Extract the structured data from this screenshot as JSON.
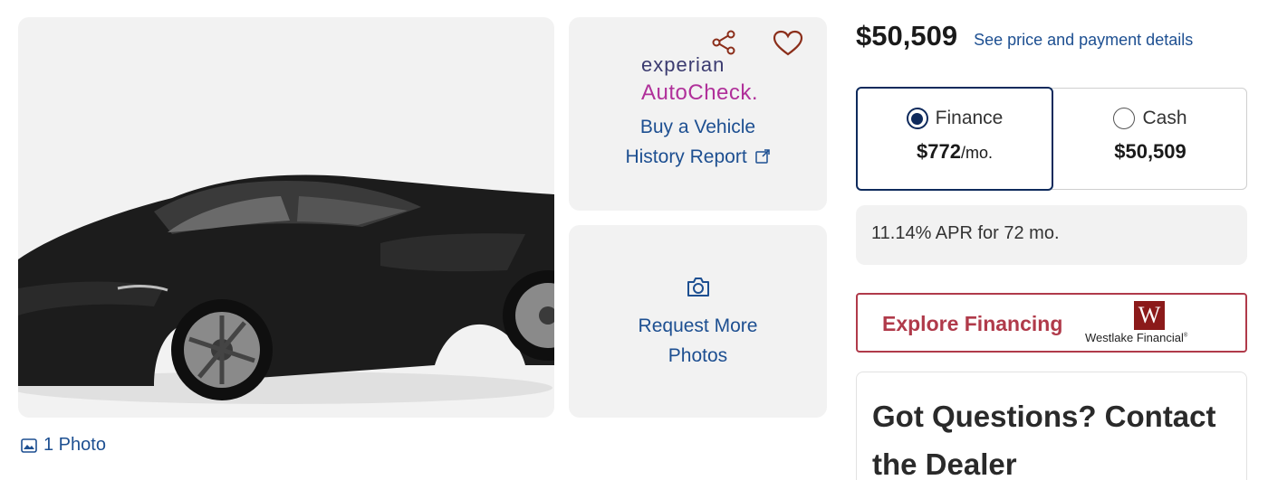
{
  "gallery": {
    "photo_count_label": "1 Photo"
  },
  "history_card": {
    "brand_top": "experian",
    "brand_bottom": "AutoCheck.",
    "link_line1": "Buy a Vehicle",
    "link_line2": "History Report"
  },
  "photos_card": {
    "link_line1": "Request More",
    "link_line2": "Photos"
  },
  "pricing": {
    "price": "$50,509",
    "details_link": "See price and payment details",
    "finance": {
      "label": "Finance",
      "amount": "$772",
      "unit": "/mo.",
      "selected": true
    },
    "cash": {
      "label": "Cash",
      "amount": "$50,509",
      "selected": false
    },
    "apr_text": "11.14% APR for 72 mo."
  },
  "financing": {
    "button_label": "Explore Financing",
    "partner_logo_letter": "W",
    "partner_name": "Westlake Financial"
  },
  "contact": {
    "title": "Got Questions? Contact the Dealer"
  },
  "colors": {
    "link_blue": "#1d4f91",
    "navy": "#0e2a5c",
    "finance_red": "#b03a4a",
    "card_gray": "#f2f2f2"
  },
  "icons": {
    "share": "share-icon",
    "favorite": "heart-icon",
    "external": "external-link-icon",
    "camera": "camera-icon",
    "image": "image-icon"
  }
}
